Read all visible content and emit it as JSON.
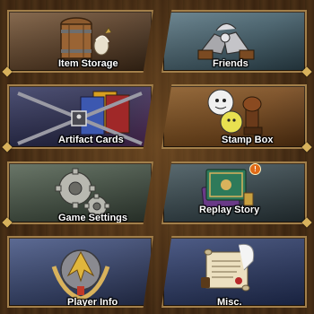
{
  "menu": {
    "item_storage": "Item Storage",
    "friends": "Friends",
    "artifact_cards": "Artifact Cards",
    "stamp_box": "Stamp Box",
    "game_settings": "Game Settings",
    "replay_story": "Replay Story",
    "player_info": "Player Info",
    "misc": "Misc."
  },
  "badges": {
    "replay_story_alert": "!"
  },
  "colors": {
    "frame_gold": "#a27f4a",
    "alert_orange": "#e06a17"
  },
  "icons": {
    "item_storage": "barrel-icon",
    "friends": "handshake-gauntlets-icon",
    "artifact_cards": "chained-cards-icon",
    "stamp_box": "stamp-icon",
    "game_settings": "gears-icon",
    "replay_story": "storybook-icon",
    "player_info": "crest-emblem-icon",
    "misc": "scroll-quill-icon"
  }
}
